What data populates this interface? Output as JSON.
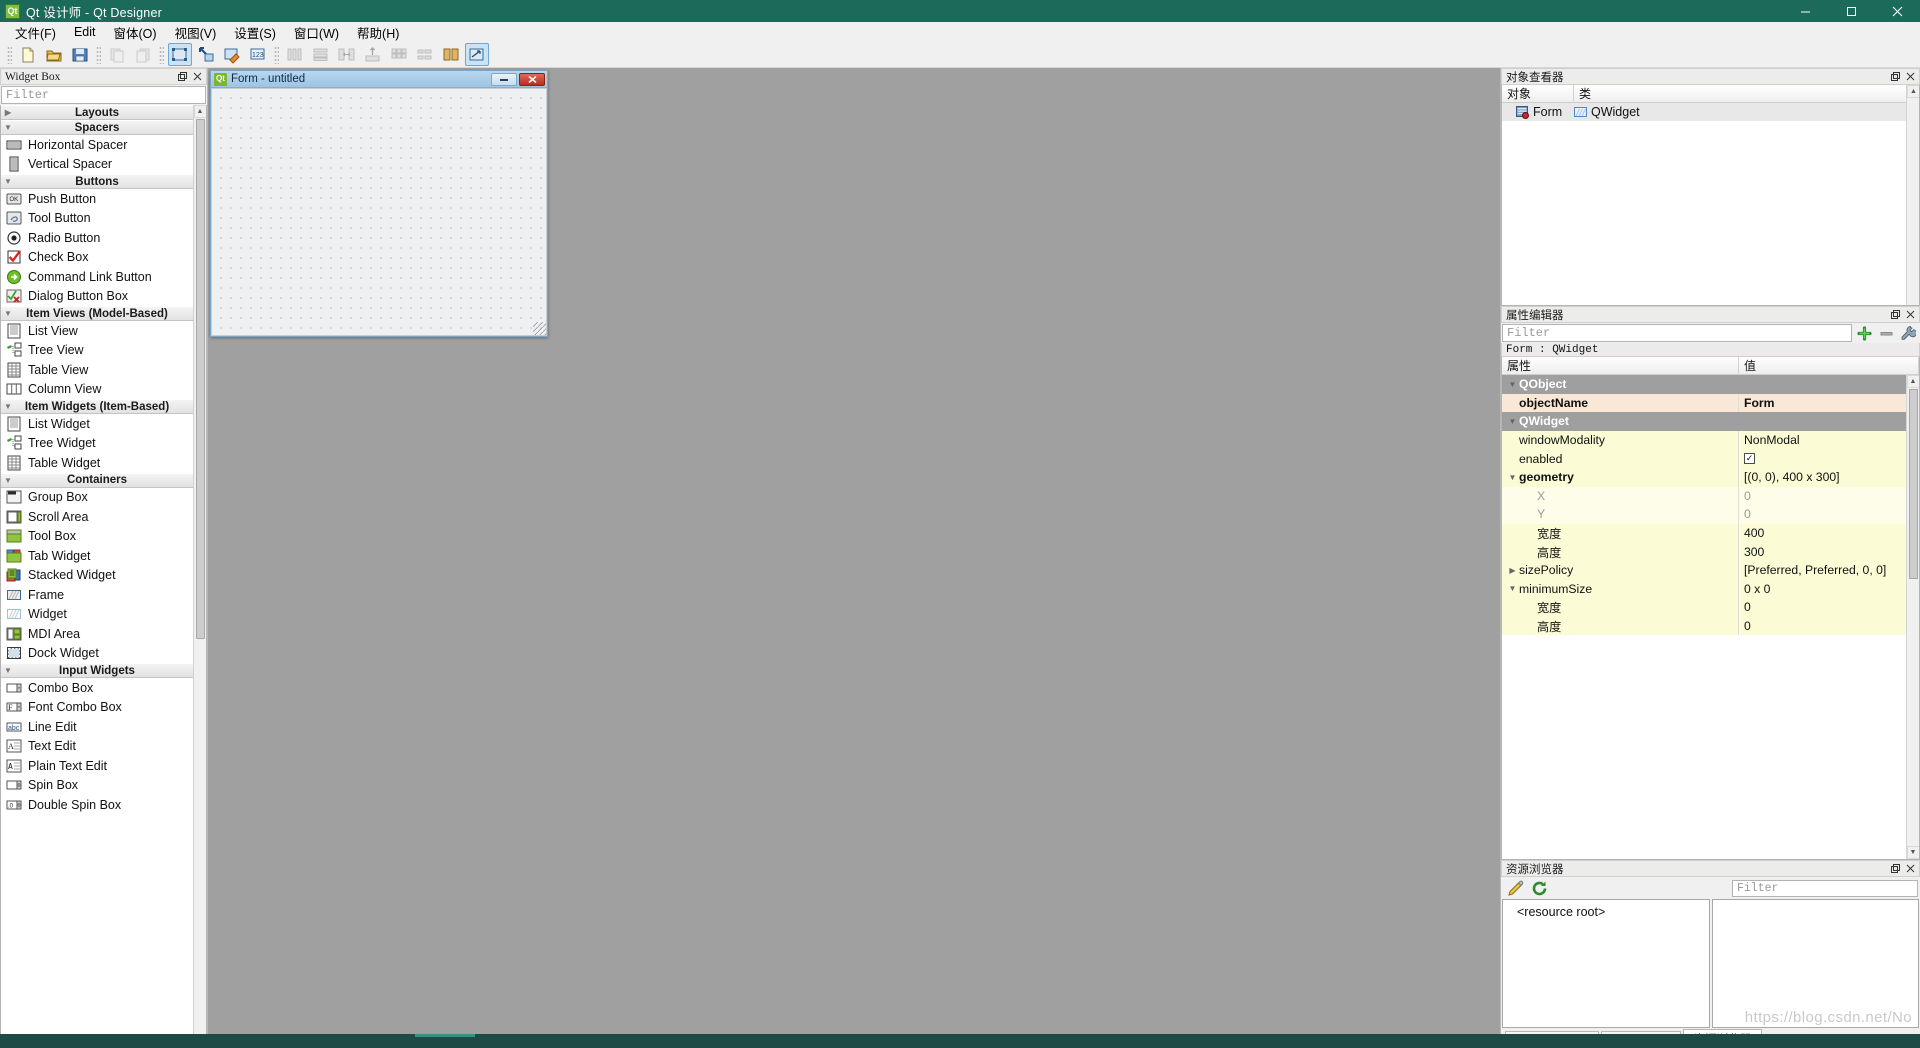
{
  "window": {
    "title": "Qt 设计师 - Qt Designer",
    "app_icon": "Qt",
    "minimize_icon": "minimize-icon",
    "maximize_icon": "maximize-icon",
    "close_icon": "close-icon"
  },
  "menubar": {
    "items": [
      {
        "label": "文件(F)"
      },
      {
        "label": "Edit"
      },
      {
        "label": "窗体(O)"
      },
      {
        "label": "视图(V)"
      },
      {
        "label": "设置(S)"
      },
      {
        "label": "窗口(W)"
      },
      {
        "label": "帮助(H)"
      }
    ]
  },
  "toolbar": {
    "groups": [
      {
        "buttons": [
          {
            "name": "new-form-button",
            "icon": "new-document-icon",
            "state": "enabled"
          },
          {
            "name": "open-form-button",
            "icon": "open-folder-icon",
            "state": "enabled"
          },
          {
            "name": "save-form-button",
            "icon": "save-disk-icon",
            "state": "enabled"
          }
        ]
      },
      {
        "buttons": [
          {
            "name": "undo-button",
            "icon": "undo-icon",
            "state": "disabled"
          },
          {
            "name": "redo-button",
            "icon": "redo-icon",
            "state": "disabled"
          }
        ]
      },
      {
        "buttons": [
          {
            "name": "edit-widgets-button",
            "icon": "edit-widgets-icon",
            "state": "active"
          },
          {
            "name": "edit-signals-slots-button",
            "icon": "signal-slot-icon",
            "state": "enabled"
          },
          {
            "name": "edit-buddies-button",
            "icon": "buddy-icon",
            "state": "enabled"
          },
          {
            "name": "edit-tab-order-button",
            "icon": "tab-order-icon",
            "state": "enabled"
          }
        ]
      },
      {
        "buttons": [
          {
            "name": "layout-horizontally-button",
            "icon": "layout-horizontal-icon",
            "state": "disabled"
          },
          {
            "name": "layout-vertically-button",
            "icon": "layout-vertical-icon",
            "state": "disabled"
          },
          {
            "name": "layout-in-splitter-h-button",
            "icon": "splitter-horizontal-icon",
            "state": "disabled"
          },
          {
            "name": "layout-in-splitter-v-button",
            "icon": "splitter-vertical-icon",
            "state": "disabled"
          },
          {
            "name": "layout-grid-button",
            "icon": "layout-grid-icon",
            "state": "disabled"
          },
          {
            "name": "layout-form-button",
            "icon": "layout-form-icon",
            "state": "disabled"
          },
          {
            "name": "break-layout-button",
            "icon": "break-layout-icon",
            "state": "enabled"
          },
          {
            "name": "adjust-size-button",
            "icon": "adjust-size-icon",
            "state": "active"
          }
        ]
      }
    ]
  },
  "widget_box": {
    "title": "Widget Box",
    "float_icon": "float-icon",
    "close_icon": "close-icon",
    "filter_placeholder": "Filter",
    "categories": [
      {
        "label": "Layouts",
        "expanded": false,
        "items": []
      },
      {
        "label": "Spacers",
        "expanded": true,
        "items": [
          {
            "label": "Horizontal Spacer",
            "icon": "horizontal-spacer-icon"
          },
          {
            "label": "Vertical Spacer",
            "icon": "vertical-spacer-icon"
          }
        ]
      },
      {
        "label": "Buttons",
        "expanded": true,
        "items": [
          {
            "label": "Push Button",
            "icon": "push-button-icon"
          },
          {
            "label": "Tool Button",
            "icon": "tool-button-icon"
          },
          {
            "label": "Radio Button",
            "icon": "radio-button-icon"
          },
          {
            "label": "Check Box",
            "icon": "check-box-icon"
          },
          {
            "label": "Command Link Button",
            "icon": "command-link-icon"
          },
          {
            "label": "Dialog Button Box",
            "icon": "dialog-button-box-icon"
          }
        ]
      },
      {
        "label": "Item Views (Model-Based)",
        "expanded": true,
        "items": [
          {
            "label": "List View",
            "icon": "list-view-icon"
          },
          {
            "label": "Tree View",
            "icon": "tree-view-icon"
          },
          {
            "label": "Table View",
            "icon": "table-view-icon"
          },
          {
            "label": "Column View",
            "icon": "column-view-icon"
          }
        ]
      },
      {
        "label": "Item Widgets (Item-Based)",
        "expanded": true,
        "items": [
          {
            "label": "List Widget",
            "icon": "list-widget-icon"
          },
          {
            "label": "Tree Widget",
            "icon": "tree-widget-icon"
          },
          {
            "label": "Table Widget",
            "icon": "table-widget-icon"
          }
        ]
      },
      {
        "label": "Containers",
        "expanded": true,
        "items": [
          {
            "label": "Group Box",
            "icon": "group-box-icon"
          },
          {
            "label": "Scroll Area",
            "icon": "scroll-area-icon"
          },
          {
            "label": "Tool Box",
            "icon": "tool-box-icon"
          },
          {
            "label": "Tab Widget",
            "icon": "tab-widget-icon"
          },
          {
            "label": "Stacked Widget",
            "icon": "stacked-widget-icon"
          },
          {
            "label": "Frame",
            "icon": "frame-icon"
          },
          {
            "label": "Widget",
            "icon": "widget-icon"
          },
          {
            "label": "MDI Area",
            "icon": "mdi-area-icon"
          },
          {
            "label": "Dock Widget",
            "icon": "dock-widget-icon"
          }
        ]
      },
      {
        "label": "Input Widgets",
        "expanded": true,
        "items": [
          {
            "label": "Combo Box",
            "icon": "combo-box-icon"
          },
          {
            "label": "Font Combo Box",
            "icon": "font-combo-box-icon"
          },
          {
            "label": "Line Edit",
            "icon": "line-edit-icon"
          },
          {
            "label": "Text Edit",
            "icon": "text-edit-icon"
          },
          {
            "label": "Plain Text Edit",
            "icon": "plain-text-edit-icon"
          },
          {
            "label": "Spin Box",
            "icon": "spin-box-icon"
          },
          {
            "label": "Double Spin Box",
            "icon": "double-spin-box-icon"
          }
        ]
      }
    ]
  },
  "form_window": {
    "icon": "Qt",
    "title": "Form - untitled",
    "minimize_label": "—",
    "close_label": "✕"
  },
  "object_inspector": {
    "title": "对象查看器",
    "float_icon": "float-icon",
    "close_icon": "close-icon",
    "columns": [
      "对象",
      "类"
    ],
    "rows": [
      {
        "object": "Form",
        "class": "QWidget",
        "object_icon": "form-icon",
        "class_icon": "widget-icon"
      }
    ]
  },
  "property_editor": {
    "title": "属性编辑器",
    "float_icon": "float-icon",
    "close_icon": "close-icon",
    "filter_placeholder": "Filter",
    "add_icon": "add-plus-icon",
    "remove_icon": "remove-minus-icon",
    "config_icon": "wrench-icon",
    "object_line": "Form : QWidget",
    "columns": [
      "属性",
      "值"
    ],
    "rows": [
      {
        "kind": "group",
        "name": "QObject",
        "value": "",
        "expand": "v",
        "indent": 0
      },
      {
        "kind": "objname",
        "name": "objectName",
        "value": "Form",
        "expand": "",
        "indent": 1
      },
      {
        "kind": "group",
        "name": "QWidget",
        "value": "",
        "expand": "v",
        "indent": 0
      },
      {
        "kind": "y1",
        "name": "windowModality",
        "value": "NonModal",
        "expand": "",
        "indent": 1
      },
      {
        "kind": "y1",
        "name": "enabled",
        "value": "checkbox-checked",
        "expand": "",
        "indent": 1
      },
      {
        "kind": "y1",
        "name": "geometry",
        "value": "[(0, 0), 400 x 300]",
        "expand": "v",
        "indent": 0,
        "bold": true
      },
      {
        "kind": "y2",
        "name": "X",
        "value": "0",
        "expand": "",
        "indent": 2,
        "dim": true
      },
      {
        "kind": "y2",
        "name": "Y",
        "value": "0",
        "expand": "",
        "indent": 2,
        "dim": true
      },
      {
        "kind": "y1",
        "name": "宽度",
        "value": "400",
        "expand": "",
        "indent": 2
      },
      {
        "kind": "y1",
        "name": "高度",
        "value": "300",
        "expand": "",
        "indent": 2
      },
      {
        "kind": "y1",
        "name": "sizePolicy",
        "value": "[Preferred, Preferred, 0, 0]",
        "expand": ">",
        "indent": 0
      },
      {
        "kind": "y1",
        "name": "minimumSize",
        "value": "0 x 0",
        "expand": "v",
        "indent": 0
      },
      {
        "kind": "y1",
        "name": "宽度",
        "value": "0",
        "expand": "",
        "indent": 2
      },
      {
        "kind": "y1",
        "name": "高度",
        "value": "0",
        "expand": "",
        "indent": 2
      }
    ]
  },
  "resource_browser": {
    "title": "资源浏览器",
    "float_icon": "float-icon",
    "close_icon": "close-icon",
    "edit_icon": "pencil-edit-icon",
    "reload_icon": "reload-refresh-icon",
    "filter_placeholder": "Filter",
    "tree_items": [
      "<resource root>"
    ],
    "tabs": [
      {
        "label": "信号/槽编辑器",
        "active": false
      },
      {
        "label": "动作编辑器",
        "active": false
      },
      {
        "label": "资源浏览器",
        "active": true
      }
    ]
  },
  "watermark": "https://blog.csdn.net/No",
  "colors": {
    "titlebar": "#1c6b5a",
    "mdi_background": "#a0a0a0",
    "property_group": "#9f9f9f",
    "property_objname": "#fae8d6",
    "property_yellow": "#fbfbd6",
    "form_title": "#9ec4e4",
    "qt_green": "#7ab72b"
  }
}
